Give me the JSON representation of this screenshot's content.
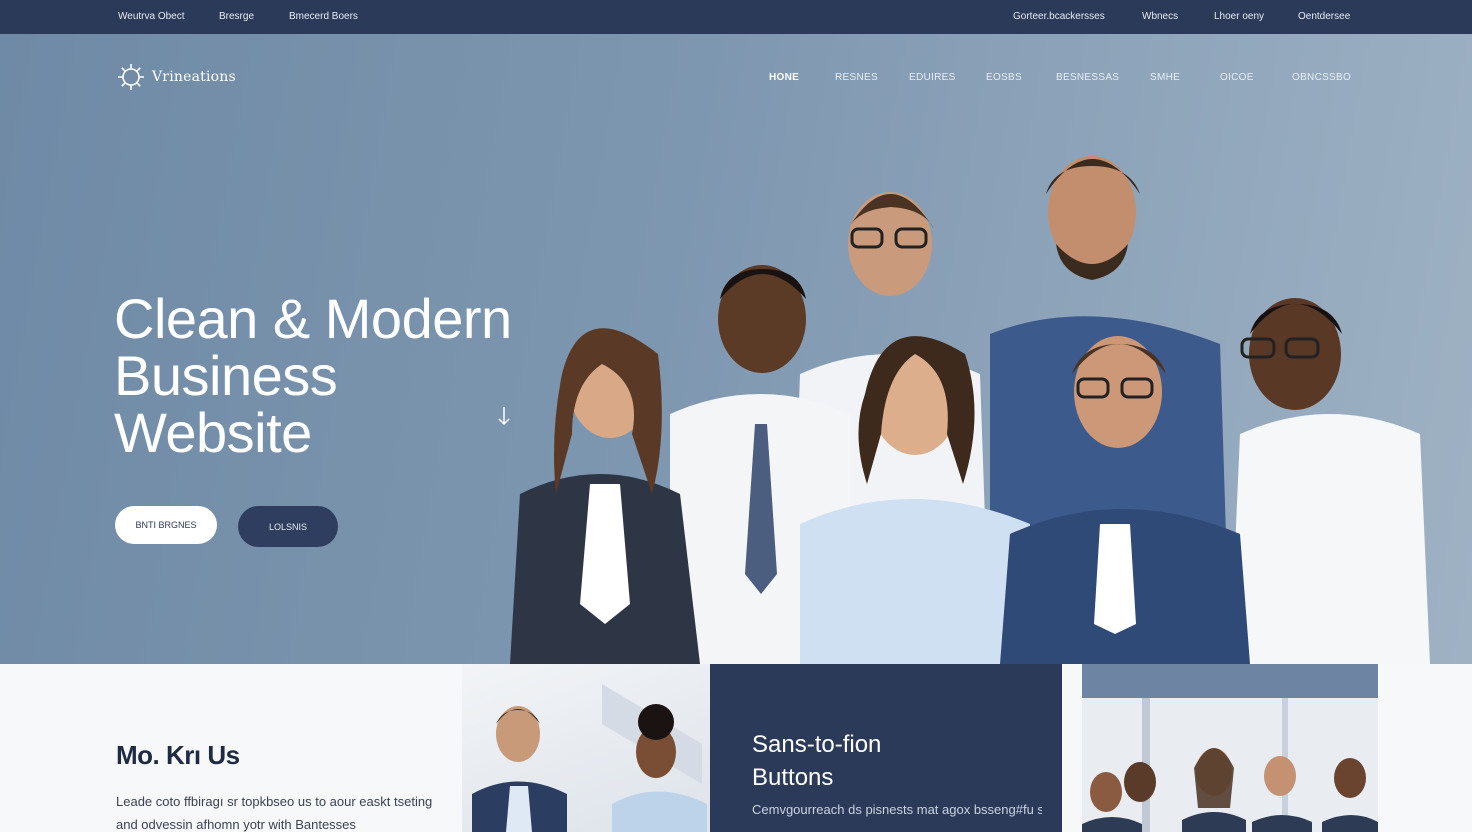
{
  "topbar": {
    "left_links": [
      "Weutrva Obect",
      "Bresrge",
      "Bmecerd Boers"
    ],
    "right_links": [
      "Gorteer.bcackersses",
      "Wbnecs",
      "Lhoer oeny",
      "Oentdersee"
    ]
  },
  "brand": {
    "name": "Vrineations",
    "icon": "gear-sun-logo-icon"
  },
  "nav": {
    "items": [
      "HONE",
      "RESNES",
      "EDUIRES",
      "EOSBS",
      "BESNESSAS",
      "SMHE",
      "OICOE",
      "OBNCSSBO"
    ],
    "active_index": 0
  },
  "hero": {
    "headline": [
      "Clean & Modern",
      "Business",
      "Website"
    ],
    "scroll_icon": "arrow-down-icon",
    "primary_button": "BNTI BRGNES",
    "secondary_button": "LOLSNIS"
  },
  "about": {
    "title": "Mo. Krı Us",
    "text": "Leade coto ffbiragı sr topkbseo us to aour easkt tseting and odvessin afhomn yotr with Bantesses"
  },
  "panel": {
    "title_lines": [
      "Sans-to-fion",
      "Buttons"
    ],
    "text": "Cemvgourreach ds pisnests mat agox bsseng#fu ssrenrtsyses ene fanr"
  },
  "colors": {
    "topbar": "#2b3a58",
    "hero_start": "#6f8aa6",
    "hero_end": "#9fb2c4",
    "dark_panel": "#2b3a58",
    "button_dark": "#2f3e5e",
    "text_dark": "#1f2b44"
  }
}
